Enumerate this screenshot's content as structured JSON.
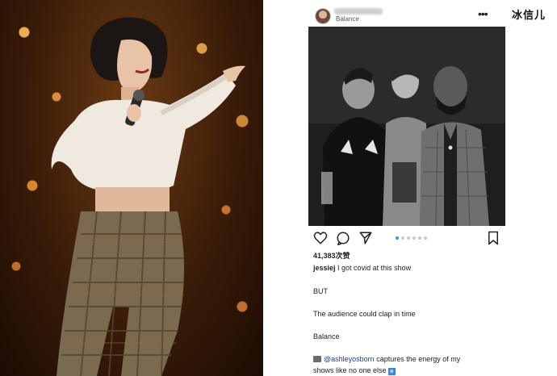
{
  "post": {
    "location": "Balance",
    "likes": "41,383次赞",
    "username": "jessiej",
    "caption_first": "I got covid at this show",
    "caption_lines": [
      "BUT",
      "The audience could clap in time",
      "Balance"
    ],
    "mention": "@ashleyosborn",
    "mention_tail": "captures the energy of my",
    "last_line": "shows like no one else",
    "carousel_total": 6,
    "carousel_active": 1
  },
  "watermark": "冰信儿",
  "colors": {
    "mention": "#20418a",
    "carousel_active": "#3897f0"
  }
}
